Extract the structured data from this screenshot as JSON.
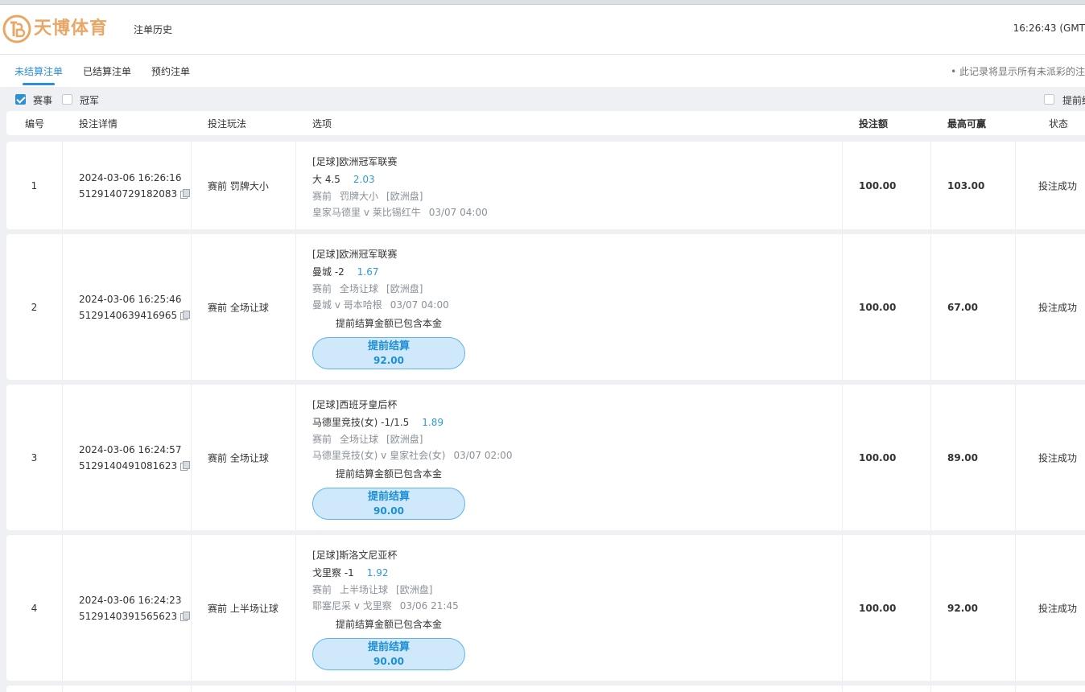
{
  "header": {
    "logo_text": "天博体育",
    "nav_label": "注单历史",
    "time": "16:26:43 (GMT"
  },
  "tabs": [
    {
      "label": "未结算注单",
      "active": true
    },
    {
      "label": "已结算注单",
      "active": false
    },
    {
      "label": "预约注单",
      "active": false
    }
  ],
  "tab_note": "• 此记录将显示所有未派彩的注",
  "filters": [
    {
      "label": "赛事",
      "checked": true
    },
    {
      "label": "冠军",
      "checked": false
    }
  ],
  "filter_right_label": "提前结",
  "columns": {
    "no": "编号",
    "detail": "投注详情",
    "play": "投注玩法",
    "option": "选项",
    "amount": "投注额",
    "max_win": "最高可赢",
    "status": "状态"
  },
  "bets": [
    {
      "no": "1",
      "time": "2024-03-06 16:26:16",
      "id": "5129140729182083",
      "play": "赛前 罚牌大小",
      "league": "[足球]欧洲冠军联赛",
      "pick": "大 4.5",
      "odds": "2.03",
      "meta_stage": "赛前",
      "meta_market": "罚牌大小",
      "meta_odds_type": "[欧洲盘]",
      "match": "皇家马德里 v 莱比锡红牛",
      "match_time": "03/07 04:00",
      "amount": "100.00",
      "max_win": "103.00",
      "status": "投注成功"
    },
    {
      "no": "2",
      "time": "2024-03-06 16:25:46",
      "id": "5129140639416965",
      "play": "赛前 全场让球",
      "league": "[足球]欧洲冠军联赛",
      "pick": "曼城 -2",
      "odds": "1.67",
      "meta_stage": "赛前",
      "meta_market": "全场让球",
      "meta_odds_type": "[欧洲盘]",
      "match": "曼城 v 哥本哈根",
      "match_time": "03/07 04:00",
      "note": "提前结算金额已包含本金",
      "cashout_label": "提前结算",
      "cashout_amount": "92.00",
      "amount": "100.00",
      "max_win": "67.00",
      "status": "投注成功"
    },
    {
      "no": "3",
      "time": "2024-03-06 16:24:57",
      "id": "5129140491081623",
      "play": "赛前 全场让球",
      "league": "[足球]西班牙皇后杯",
      "pick": "马德里竞技(女) -1/1.5",
      "odds": "1.89",
      "meta_stage": "赛前",
      "meta_market": "全场让球",
      "meta_odds_type": "[欧洲盘]",
      "match": "马德里竞技(女) v 皇家社会(女)",
      "match_time": "03/07 02:00",
      "note": "提前结算金额已包含本金",
      "cashout_label": "提前结算",
      "cashout_amount": "90.00",
      "amount": "100.00",
      "max_win": "89.00",
      "status": "投注成功"
    },
    {
      "no": "4",
      "time": "2024-03-06 16:24:23",
      "id": "5129140391565623",
      "play": "赛前 上半场让球",
      "league": "[足球]斯洛文尼亚杯",
      "pick": "戈里察 -1",
      "odds": "1.92",
      "meta_stage": "赛前",
      "meta_market": "上半场让球",
      "meta_odds_type": "[欧洲盘]",
      "match": "耶塞尼采 v 戈里察",
      "match_time": "03/06 21:45",
      "note": "提前结算金额已包含本金",
      "cashout_label": "提前结算",
      "cashout_amount": "90.00",
      "amount": "100.00",
      "max_win": "92.00",
      "status": "投注成功"
    }
  ],
  "colors": {
    "accent": "#2e8fd6",
    "odds": "#2e9ad6",
    "logo": "#e9a766",
    "cashout_bg": "#cfe9fb"
  }
}
